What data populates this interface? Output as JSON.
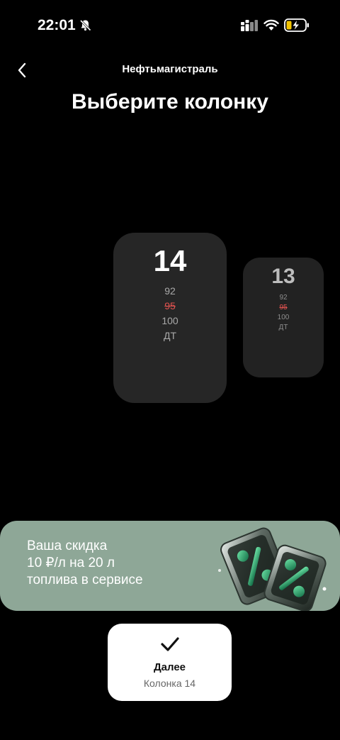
{
  "status_bar": {
    "time": "22:01",
    "icons": [
      "bell-off-icon",
      "signal-icon",
      "wifi-icon",
      "battery-charging-icon"
    ]
  },
  "header": {
    "title": "Нефтьмагистраль",
    "back_icon": "chevron-left-icon"
  },
  "page_title": "Выберите колонку",
  "pumps": [
    {
      "number": "14",
      "selected": true,
      "fuels": [
        "92",
        "95",
        "100",
        "ДТ"
      ],
      "unavailable_fuels": [
        "95"
      ]
    },
    {
      "number": "13",
      "selected": false,
      "fuels": [
        "92",
        "95",
        "100",
        "ДТ"
      ],
      "unavailable_fuels": [
        "95"
      ]
    }
  ],
  "promo": {
    "line1": "Ваша скидка",
    "line2": "10 ₽/л на 20 л",
    "line3": "топлива в сервисе",
    "art_icon": "discount-coupons-icon"
  },
  "next_button": {
    "icon": "check-icon",
    "label": "Далее",
    "sublabel": "Колонка 14"
  },
  "colors": {
    "background": "#000000",
    "card": "#262626",
    "unavailable_fuel": "#e0524f",
    "promo_bg": "#8ea797",
    "button_bg": "#ffffff"
  }
}
